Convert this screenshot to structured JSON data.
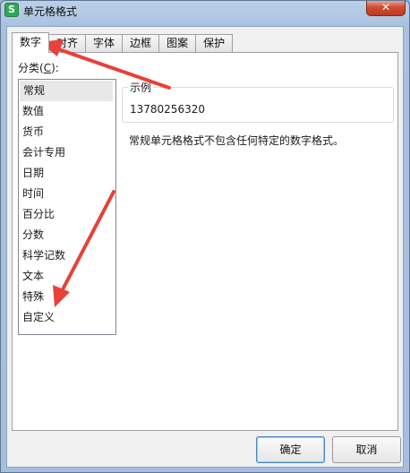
{
  "window": {
    "title": "单元格格式",
    "app_icon_glyph": "S",
    "close_glyph": "✕"
  },
  "tabs": [
    {
      "label": "数字",
      "active": true
    },
    {
      "label": "对齐"
    },
    {
      "label": "字体"
    },
    {
      "label": "边框"
    },
    {
      "label": "图案"
    },
    {
      "label": "保护"
    }
  ],
  "category": {
    "label_prefix": "分类(",
    "label_key": "C",
    "label_suffix": "):",
    "items": [
      "常规",
      "数值",
      "货币",
      "会计专用",
      "日期",
      "时间",
      "百分比",
      "分数",
      "科学记数",
      "文本",
      "特殊",
      "自定义"
    ],
    "selected": "常规"
  },
  "sample": {
    "legend": "示例",
    "value": "13780256320"
  },
  "description": "常规单元格格式不包含任何特定的数字格式。",
  "buttons": {
    "ok": "确定",
    "cancel": "取消"
  },
  "annotation_color": "#e8403a"
}
